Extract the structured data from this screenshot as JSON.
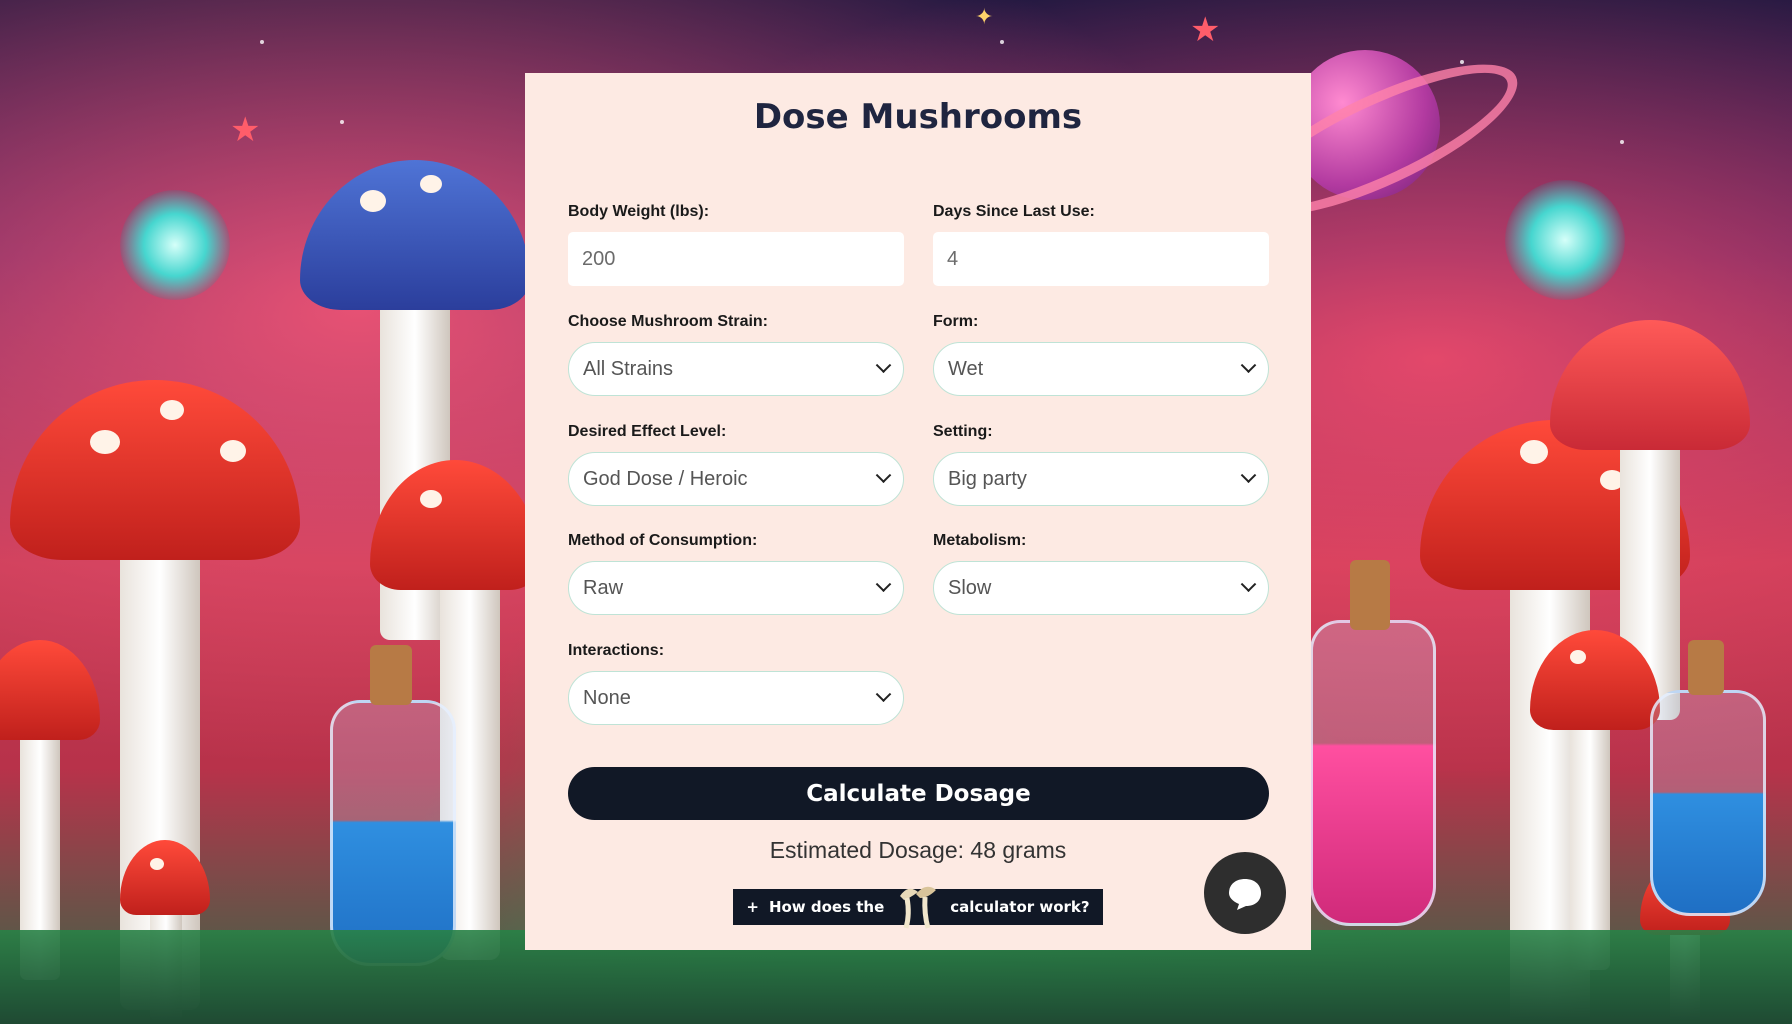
{
  "title": "Dose Mushrooms",
  "fields": {
    "body_weight": {
      "label": "Body Weight (lbs):",
      "value": "200"
    },
    "days_since": {
      "label": "Days Since Last Use:",
      "value": "4"
    },
    "strain": {
      "label": "Choose Mushroom Strain:",
      "value": "All Strains"
    },
    "form": {
      "label": "Form:",
      "value": "Wet"
    },
    "effect": {
      "label": "Desired Effect Level:",
      "value": "God Dose / Heroic"
    },
    "setting": {
      "label": "Setting:",
      "value": "Big party"
    },
    "method": {
      "label": "Method of Consumption:",
      "value": "Raw"
    },
    "metabolism": {
      "label": "Metabolism:",
      "value": "Slow"
    },
    "interactions": {
      "label": "Interactions:",
      "value": "None"
    }
  },
  "calculate_label": "Calculate Dosage",
  "result_text": "Estimated Dosage: 48 grams",
  "how_button": {
    "prefix": "+",
    "text_before": "How does the",
    "text_after": "calculator work?"
  },
  "icons": {
    "chat": "chat-bubble-icon",
    "dropdown": "chevron-down-icon",
    "mushroom": "mushroom-icon"
  },
  "colors": {
    "panel": "#fdeae3",
    "button": "#111826",
    "title": "#1f2540"
  }
}
